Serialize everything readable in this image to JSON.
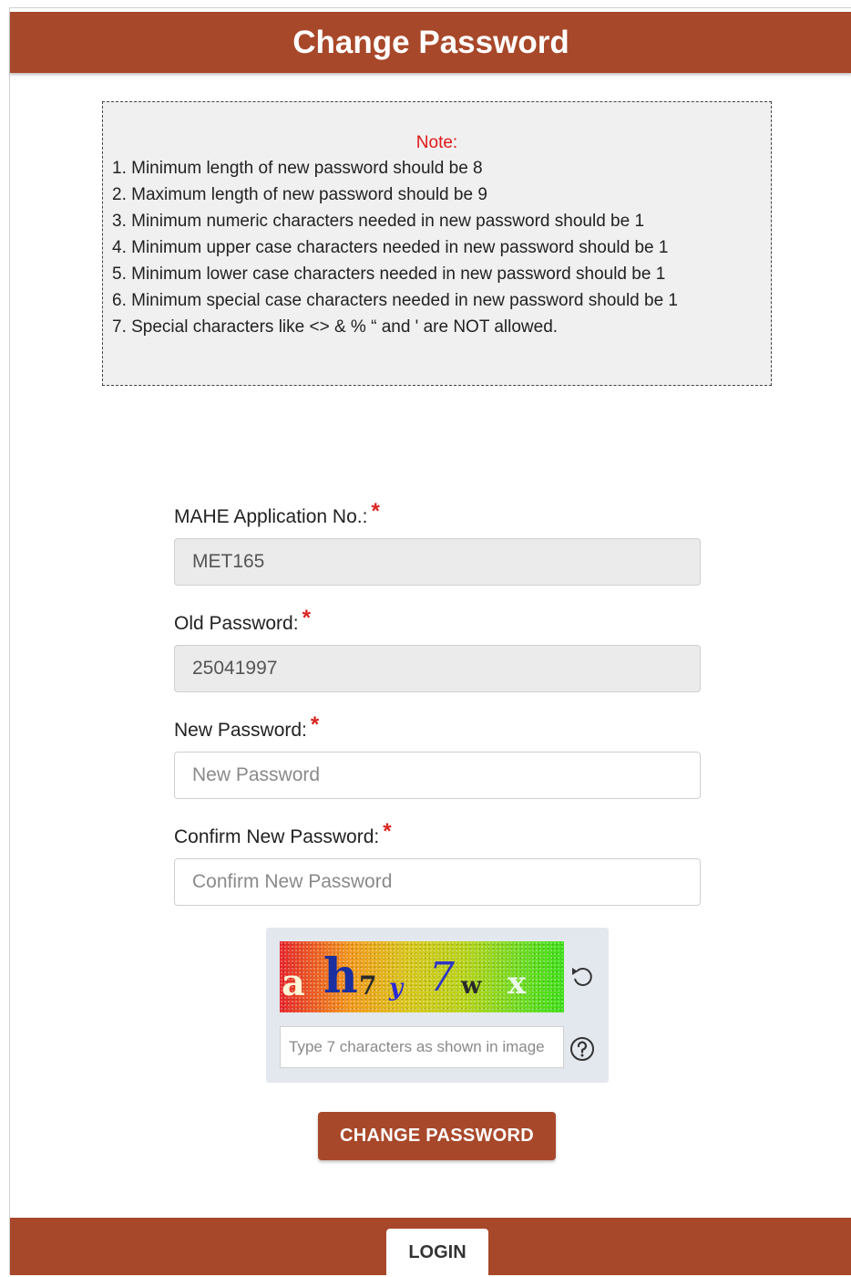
{
  "header": {
    "title": "Change Password"
  },
  "note": {
    "title": "Note:",
    "items": [
      "1. Minimum length of new password should be 8",
      "2. Maximum length of new password should be 9",
      "3. Minimum numeric characters needed in new password should be 1",
      "4. Minimum upper case characters needed in new password should be 1",
      "5. Minimum lower case characters needed in new password should be 1",
      "6. Minimum special case characters needed in new password should be 1",
      "7. Special characters like <> & % “ and ' are NOT allowed."
    ]
  },
  "form": {
    "application_no": {
      "label": "MAHE Application No.:",
      "required": "*",
      "value": "MET165"
    },
    "old_password": {
      "label": "Old Password:",
      "required": "*",
      "value": "25041997"
    },
    "new_password": {
      "label": "New Password:",
      "required": "*",
      "placeholder": "New Password"
    },
    "confirm_password": {
      "label": "Confirm New Password:",
      "required": "*",
      "placeholder": "Confirm New Password"
    }
  },
  "captcha": {
    "glyphs": [
      "a",
      "h",
      "7",
      "y",
      "7",
      "w",
      "x"
    ],
    "input_placeholder": "Type 7 characters as shown in image",
    "refresh_icon": "refresh-icon",
    "help_icon": "help-icon"
  },
  "actions": {
    "change_password_label": "CHANGE PASSWORD"
  },
  "footer": {
    "login_label": "LOGIN"
  },
  "colors": {
    "brand": "#a8482a",
    "required": "#d9241f",
    "note_title": "#e01818"
  }
}
